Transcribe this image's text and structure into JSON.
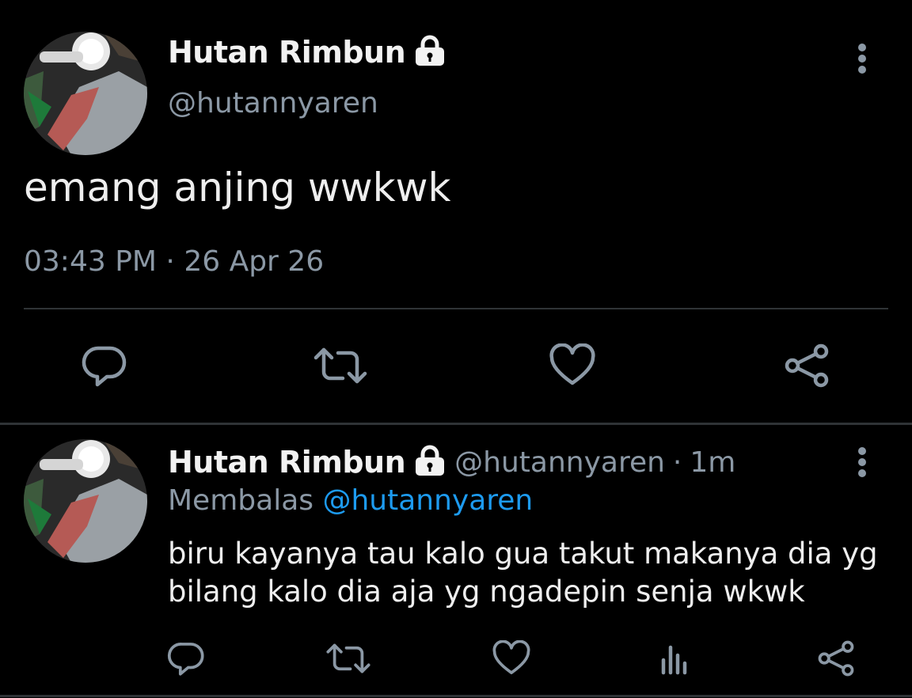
{
  "main_tweet": {
    "display_name": "Hutan Rimbun",
    "handle": "@hutannyaren",
    "text": "emang anjing wwkwk",
    "time": "03:43 PM",
    "separator": "·",
    "date": "26 Apr 26"
  },
  "reply": {
    "display_name": "Hutan Rimbun",
    "handle": "@hutannyaren",
    "separator": "·",
    "age": "1m",
    "replying_prefix": "Membalas",
    "replying_to": "@hutannyaren",
    "text_line1": "biru kayanya tau kalo gua takut makanya dia yg",
    "text_line2": "bilang kalo dia aja yg ngadepin senja wkwk"
  },
  "icons": {
    "lock": "lock-icon",
    "more": "more-vertical-icon",
    "reply": "reply-icon",
    "retweet": "retweet-icon",
    "like": "heart-icon",
    "analytics": "analytics-icon",
    "share": "share-icon"
  },
  "colors": {
    "background": "#000000",
    "secondary_text": "#8b98a5",
    "link": "#1d9bf0"
  }
}
